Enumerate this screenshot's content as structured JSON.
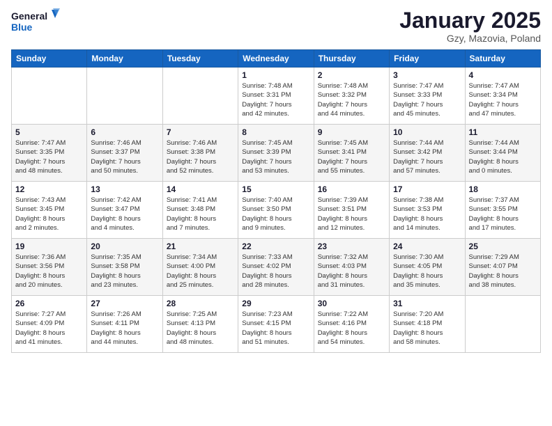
{
  "logo": {
    "line1": "General",
    "line2": "Blue"
  },
  "title": "January 2025",
  "location": "Gzy, Mazovia, Poland",
  "weekdays": [
    "Sunday",
    "Monday",
    "Tuesday",
    "Wednesday",
    "Thursday",
    "Friday",
    "Saturday"
  ],
  "weeks": [
    [
      {
        "day": "",
        "info": ""
      },
      {
        "day": "",
        "info": ""
      },
      {
        "day": "",
        "info": ""
      },
      {
        "day": "1",
        "info": "Sunrise: 7:48 AM\nSunset: 3:31 PM\nDaylight: 7 hours\nand 42 minutes."
      },
      {
        "day": "2",
        "info": "Sunrise: 7:48 AM\nSunset: 3:32 PM\nDaylight: 7 hours\nand 44 minutes."
      },
      {
        "day": "3",
        "info": "Sunrise: 7:47 AM\nSunset: 3:33 PM\nDaylight: 7 hours\nand 45 minutes."
      },
      {
        "day": "4",
        "info": "Sunrise: 7:47 AM\nSunset: 3:34 PM\nDaylight: 7 hours\nand 47 minutes."
      }
    ],
    [
      {
        "day": "5",
        "info": "Sunrise: 7:47 AM\nSunset: 3:35 PM\nDaylight: 7 hours\nand 48 minutes."
      },
      {
        "day": "6",
        "info": "Sunrise: 7:46 AM\nSunset: 3:37 PM\nDaylight: 7 hours\nand 50 minutes."
      },
      {
        "day": "7",
        "info": "Sunrise: 7:46 AM\nSunset: 3:38 PM\nDaylight: 7 hours\nand 52 minutes."
      },
      {
        "day": "8",
        "info": "Sunrise: 7:45 AM\nSunset: 3:39 PM\nDaylight: 7 hours\nand 53 minutes."
      },
      {
        "day": "9",
        "info": "Sunrise: 7:45 AM\nSunset: 3:41 PM\nDaylight: 7 hours\nand 55 minutes."
      },
      {
        "day": "10",
        "info": "Sunrise: 7:44 AM\nSunset: 3:42 PM\nDaylight: 7 hours\nand 57 minutes."
      },
      {
        "day": "11",
        "info": "Sunrise: 7:44 AM\nSunset: 3:44 PM\nDaylight: 8 hours\nand 0 minutes."
      }
    ],
    [
      {
        "day": "12",
        "info": "Sunrise: 7:43 AM\nSunset: 3:45 PM\nDaylight: 8 hours\nand 2 minutes."
      },
      {
        "day": "13",
        "info": "Sunrise: 7:42 AM\nSunset: 3:47 PM\nDaylight: 8 hours\nand 4 minutes."
      },
      {
        "day": "14",
        "info": "Sunrise: 7:41 AM\nSunset: 3:48 PM\nDaylight: 8 hours\nand 7 minutes."
      },
      {
        "day": "15",
        "info": "Sunrise: 7:40 AM\nSunset: 3:50 PM\nDaylight: 8 hours\nand 9 minutes."
      },
      {
        "day": "16",
        "info": "Sunrise: 7:39 AM\nSunset: 3:51 PM\nDaylight: 8 hours\nand 12 minutes."
      },
      {
        "day": "17",
        "info": "Sunrise: 7:38 AM\nSunset: 3:53 PM\nDaylight: 8 hours\nand 14 minutes."
      },
      {
        "day": "18",
        "info": "Sunrise: 7:37 AM\nSunset: 3:55 PM\nDaylight: 8 hours\nand 17 minutes."
      }
    ],
    [
      {
        "day": "19",
        "info": "Sunrise: 7:36 AM\nSunset: 3:56 PM\nDaylight: 8 hours\nand 20 minutes."
      },
      {
        "day": "20",
        "info": "Sunrise: 7:35 AM\nSunset: 3:58 PM\nDaylight: 8 hours\nand 23 minutes."
      },
      {
        "day": "21",
        "info": "Sunrise: 7:34 AM\nSunset: 4:00 PM\nDaylight: 8 hours\nand 25 minutes."
      },
      {
        "day": "22",
        "info": "Sunrise: 7:33 AM\nSunset: 4:02 PM\nDaylight: 8 hours\nand 28 minutes."
      },
      {
        "day": "23",
        "info": "Sunrise: 7:32 AM\nSunset: 4:03 PM\nDaylight: 8 hours\nand 31 minutes."
      },
      {
        "day": "24",
        "info": "Sunrise: 7:30 AM\nSunset: 4:05 PM\nDaylight: 8 hours\nand 35 minutes."
      },
      {
        "day": "25",
        "info": "Sunrise: 7:29 AM\nSunset: 4:07 PM\nDaylight: 8 hours\nand 38 minutes."
      }
    ],
    [
      {
        "day": "26",
        "info": "Sunrise: 7:27 AM\nSunset: 4:09 PM\nDaylight: 8 hours\nand 41 minutes."
      },
      {
        "day": "27",
        "info": "Sunrise: 7:26 AM\nSunset: 4:11 PM\nDaylight: 8 hours\nand 44 minutes."
      },
      {
        "day": "28",
        "info": "Sunrise: 7:25 AM\nSunset: 4:13 PM\nDaylight: 8 hours\nand 48 minutes."
      },
      {
        "day": "29",
        "info": "Sunrise: 7:23 AM\nSunset: 4:15 PM\nDaylight: 8 hours\nand 51 minutes."
      },
      {
        "day": "30",
        "info": "Sunrise: 7:22 AM\nSunset: 4:16 PM\nDaylight: 8 hours\nand 54 minutes."
      },
      {
        "day": "31",
        "info": "Sunrise: 7:20 AM\nSunset: 4:18 PM\nDaylight: 8 hours\nand 58 minutes."
      },
      {
        "day": "",
        "info": ""
      }
    ]
  ]
}
